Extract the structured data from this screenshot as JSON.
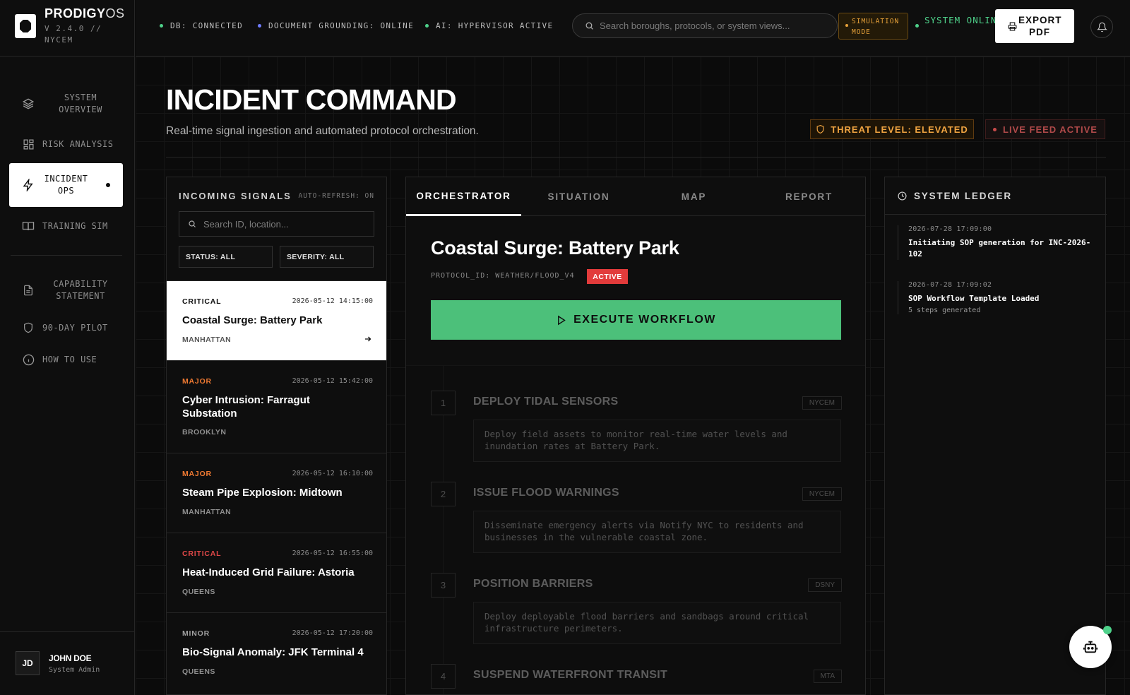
{
  "brand": {
    "name": "PRODIGY",
    "name_suffix": "OS",
    "version": "V 2.4.0 // NYCEM"
  },
  "sidebar": {
    "items": [
      {
        "label": "SYSTEM OVERVIEW",
        "icon": "layers-icon"
      },
      {
        "label": "RISK ANALYSIS",
        "icon": "dashboard-grid-icon"
      },
      {
        "label": "INCIDENT OPS",
        "icon": "lightning-icon",
        "active": true
      },
      {
        "label": "TRAINING SIM",
        "icon": "book-icon"
      },
      {
        "label": "CAPABILITY STATEMENT",
        "icon": "document-icon"
      },
      {
        "label": "90-DAY PILOT",
        "icon": "shield-icon"
      },
      {
        "label": "HOW TO USE",
        "icon": "info-icon"
      }
    ],
    "user": {
      "initials": "JD",
      "name": "JOHN DOE",
      "role": "System Admin"
    }
  },
  "topbar": {
    "statuses": [
      {
        "label": "DB: CONNECTED",
        "color": "#4ed18a"
      },
      {
        "label": "DOCUMENT GROUNDING: ONLINE",
        "color": "#6f7cff"
      },
      {
        "label": "AI: HYPERVISOR ACTIVE",
        "color": "#4ed18a"
      }
    ],
    "search_placeholder": "Search boroughs, protocols, or system views...",
    "simulation_badge": "SIMULATION MODE",
    "system_status": "SYSTEM ONLINE",
    "export_label": "EXPORT PDF"
  },
  "header": {
    "title": "INCIDENT COMMAND",
    "subtitle": "Real-time signal ingestion and automated protocol orchestration.",
    "threat": "THREAT LEVEL: ELEVATED",
    "live": "LIVE FEED ACTIVE"
  },
  "signals": {
    "title": "INCOMING SIGNALS",
    "auto_refresh": "AUTO-REFRESH: ON",
    "search_placeholder": "Search ID, location...",
    "filter_status": "STATUS: ALL",
    "filter_severity": "SEVERITY: ALL",
    "items": [
      {
        "severity": "CRITICAL",
        "time": "2026-05-12 14:15:00",
        "name": "Coastal Surge: Battery Park",
        "borough": "MANHATTAN",
        "sev_color": "#0d0d0d"
      },
      {
        "severity": "MAJOR",
        "time": "2026-05-12 15:42:00",
        "name": "Cyber Intrusion: Farragut Substation",
        "borough": "BROOKLYN",
        "sev_color": "#f07a32"
      },
      {
        "severity": "MAJOR",
        "time": "2026-05-12 16:10:00",
        "name": "Steam Pipe Explosion: Midtown",
        "borough": "MANHATTAN",
        "sev_color": "#f07a32"
      },
      {
        "severity": "CRITICAL",
        "time": "2026-05-12 16:55:00",
        "name": "Heat-Induced Grid Failure: Astoria",
        "borough": "QUEENS",
        "sev_color": "#e04848"
      },
      {
        "severity": "MINOR",
        "time": "2026-05-12 17:20:00",
        "name": "Bio-Signal Anomaly: JFK Terminal 4",
        "borough": "QUEENS",
        "sev_color": "#a0a0a0"
      }
    ]
  },
  "center": {
    "tabs": [
      "ORCHESTRATOR",
      "SITUATION",
      "MAP",
      "REPORT"
    ],
    "protocol_title": "Coastal Surge: Battery Park",
    "protocol_id": "PROTOCOL_ID: WEATHER/FLOOD_V4",
    "status_badge": "ACTIVE",
    "execute_label": "EXECUTE WORKFLOW",
    "steps": [
      {
        "num": "1",
        "title": "DEPLOY TIDAL SENSORS",
        "agency": "NYCEM",
        "desc": "Deploy field assets to monitor real-time water levels and inundation rates at Battery Park."
      },
      {
        "num": "2",
        "title": "ISSUE FLOOD WARNINGS",
        "agency": "NYCEM",
        "desc": "Disseminate emergency alerts via Notify NYC to residents and businesses in the vulnerable coastal zone."
      },
      {
        "num": "3",
        "title": "POSITION BARRIERS",
        "agency": "DSNY",
        "desc": "Deploy deployable flood barriers and sandbags around critical infrastructure perimeters."
      },
      {
        "num": "4",
        "title": "SUSPEND WATERFRONT TRANSIT",
        "agency": "MTA",
        "desc": ""
      }
    ]
  },
  "ledger": {
    "title": "SYSTEM LEDGER",
    "entries": [
      {
        "time": "2026-07-28 17:09:00",
        "message": "Initiating SOP generation for INC-2026-102",
        "sub": ""
      },
      {
        "time": "2026-07-28 17:09:02",
        "message": "SOP Workflow Template Loaded",
        "sub": "5 steps generated"
      }
    ]
  }
}
